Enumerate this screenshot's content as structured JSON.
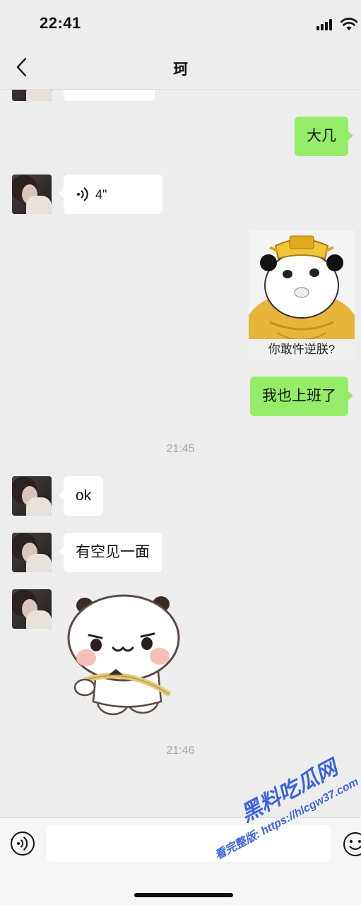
{
  "status_bar": {
    "time": "22:41"
  },
  "header": {
    "title": "珂"
  },
  "messages": {
    "right_1": "大几",
    "voice": {
      "duration": "4\""
    },
    "sticker_caption": "你敢忤逆朕?",
    "right_2": "我也上班了",
    "time_1": "21:45",
    "left_ok": "ok",
    "left_meet": "有空见一面",
    "time_2": "21:46"
  },
  "input": {
    "value": "",
    "placeholder": ""
  },
  "watermark": {
    "title": "黑料吃瓜网",
    "url": "看完整版: https://hlcgw37.com"
  },
  "colors": {
    "sent_bubble": "#95ec69",
    "received_bubble": "#ffffff",
    "background": "#ededed"
  }
}
